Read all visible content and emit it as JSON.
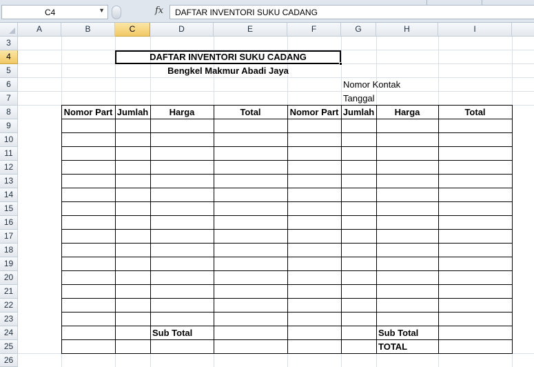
{
  "formula_bar": {
    "name_box": "C4",
    "fx_label": "fx",
    "formula": "DAFTAR INVENTORI SUKU CADANG"
  },
  "columns": [
    "A",
    "B",
    "C",
    "D",
    "E",
    "F",
    "G",
    "H",
    "I"
  ],
  "selected_column": "C",
  "rows": [
    "3",
    "4",
    "5",
    "6",
    "7",
    "8",
    "9",
    "10",
    "11",
    "12",
    "13",
    "14",
    "15",
    "16",
    "17",
    "18",
    "19",
    "20",
    "21",
    "22",
    "23",
    "24",
    "25",
    "26"
  ],
  "selected_row": "4",
  "sheet": {
    "title": "DAFTAR INVENTORI SUKU CADANG",
    "subtitle": "Bengkel Makmur Abadi Jaya",
    "contact_label": "Nomor Kontak",
    "date_label": "Tanggal",
    "table_headers": [
      "Nomor Part",
      "Jumlah",
      "Harga",
      "Total",
      "Nomor Part",
      "Jumlah",
      "Harga",
      "Total"
    ],
    "subtotal_left": "Sub Total",
    "subtotal_right": "Sub Total",
    "grand_total": "TOTAL"
  }
}
